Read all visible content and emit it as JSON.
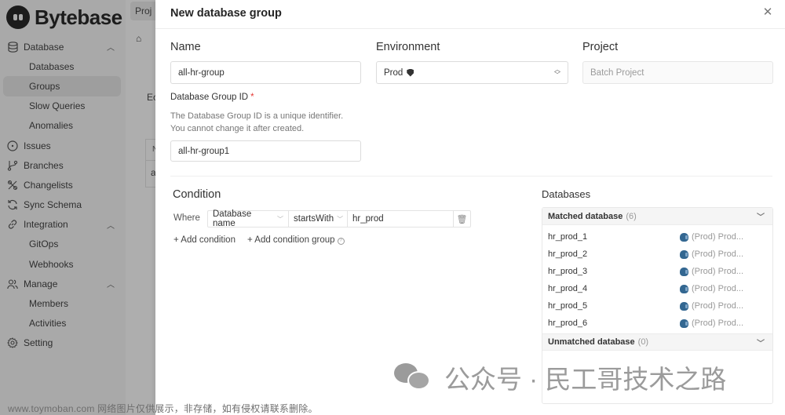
{
  "app": {
    "brand": "Bytebase"
  },
  "sidebar": {
    "items": [
      {
        "label": "Database",
        "icon": "database-icon",
        "type": "section",
        "expanded": true
      },
      {
        "label": "Databases",
        "type": "sub"
      },
      {
        "label": "Groups",
        "type": "sub",
        "active": true
      },
      {
        "label": "Slow Queries",
        "type": "sub"
      },
      {
        "label": "Anomalies",
        "type": "sub"
      },
      {
        "label": "Issues",
        "icon": "issues-icon",
        "type": "top"
      },
      {
        "label": "Branches",
        "icon": "branch-icon",
        "type": "top"
      },
      {
        "label": "Changelists",
        "icon": "changelist-icon",
        "type": "top"
      },
      {
        "label": "Sync Schema",
        "icon": "sync-icon",
        "type": "top"
      },
      {
        "label": "Integration",
        "icon": "link-icon",
        "type": "section",
        "expanded": true
      },
      {
        "label": "GitOps",
        "type": "sub"
      },
      {
        "label": "Webhooks",
        "type": "sub"
      },
      {
        "label": "Manage",
        "icon": "users-icon",
        "type": "section",
        "expanded": true
      },
      {
        "label": "Members",
        "type": "sub"
      },
      {
        "label": "Activities",
        "type": "sub"
      },
      {
        "label": "Setting",
        "icon": "gear-icon",
        "type": "top"
      }
    ]
  },
  "background_page": {
    "tab_label": "Proj",
    "edit_label": "Ec",
    "table_header": "N",
    "table_cell": "a"
  },
  "drawer": {
    "title": "New database group",
    "close_icon": "close-icon",
    "name": {
      "label": "Name",
      "value": "all-hr-group"
    },
    "environment": {
      "label": "Environment",
      "value": "Prod",
      "badge_icon": "shield-icon"
    },
    "project": {
      "label": "Project",
      "value": "Batch Project",
      "disabled": true
    },
    "group_id": {
      "label": "Database Group ID",
      "required_mark": "*",
      "help_line1": "The Database Group ID is a unique identifier.",
      "help_line2": "You cannot change it after created.",
      "value": "all-hr-group1"
    },
    "condition": {
      "title": "Condition",
      "where_label": "Where",
      "field": "Database name",
      "operator": "startsWith",
      "value": "hr_prod",
      "add_condition": "+ Add condition",
      "add_condition_group": "+ Add condition group"
    },
    "databases": {
      "title": "Databases",
      "matched": {
        "label": "Matched database",
        "count": "(6)",
        "rows": [
          {
            "name": "hr_prod_1",
            "env": "(Prod) Prod..."
          },
          {
            "name": "hr_prod_2",
            "env": "(Prod) Prod..."
          },
          {
            "name": "hr_prod_3",
            "env": "(Prod) Prod..."
          },
          {
            "name": "hr_prod_4",
            "env": "(Prod) Prod..."
          },
          {
            "name": "hr_prod_5",
            "env": "(Prod) Prod..."
          },
          {
            "name": "hr_prod_6",
            "env": "(Prod) Prod..."
          }
        ]
      },
      "unmatched": {
        "label": "Unmatched database",
        "count": "(0)"
      }
    }
  },
  "watermarks": {
    "wechat": "公众号 · 民工哥技术之路",
    "site": "www.toymoban.com 网络图片仅供展示，非存储，如有侵权请联系删除。"
  }
}
